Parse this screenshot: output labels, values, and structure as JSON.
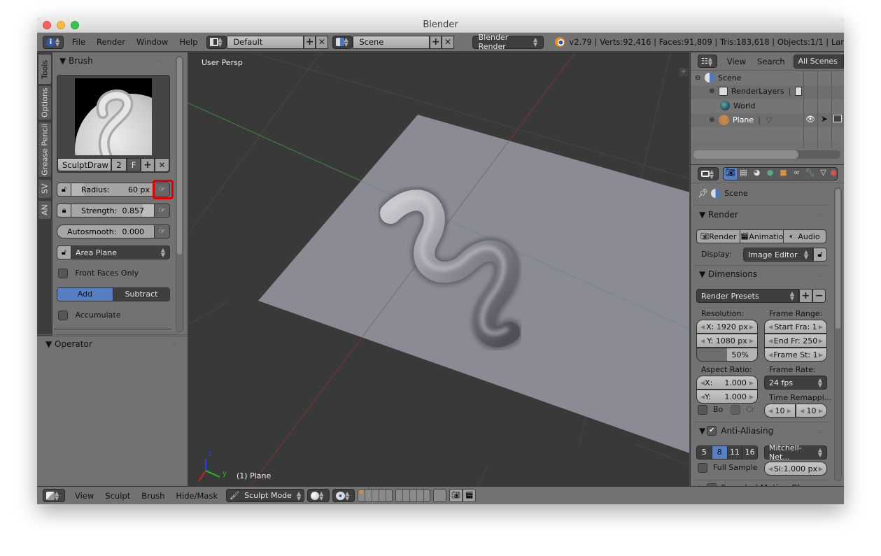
{
  "window": {
    "title": "Blender"
  },
  "topbar": {
    "menus": [
      "File",
      "Render",
      "Window",
      "Help"
    ],
    "layout": "Default",
    "scene": "Scene",
    "engine": "Blender Render",
    "stats": "v2.79 | Verts:92,416 | Faces:91,809 | Tris:183,618 | Objects:1/1 | Lar"
  },
  "toolshelf": {
    "tabs": [
      "Tools",
      "Options",
      "Grease Pencil",
      "SV",
      "AN"
    ],
    "brush_panel": "Brush",
    "brush_name": "SculptDraw",
    "brush_users": "2",
    "fake_user": "F",
    "radius_label": "Radius:",
    "radius_value": "60 px",
    "strength_label": "Strength:",
    "strength_value": "0.857",
    "strength_fraction": 0.857,
    "autosmooth_label": "Autosmooth:",
    "autosmooth_value": "0.000",
    "sculpt_plane": "Area Plane",
    "front_faces_only": "Front Faces Only",
    "add_label": "Add",
    "subtract_label": "Subtract",
    "accumulate": "Accumulate",
    "operator_panel": "Operator"
  },
  "viewport": {
    "view_name": "User Persp",
    "object_label": "(1) Plane",
    "axis_labels": {
      "z": "z",
      "y": "y",
      "x": "x"
    }
  },
  "outliner": {
    "menus": [
      "View",
      "Search"
    ],
    "filter": "All Scenes",
    "items": [
      {
        "label": "Scene",
        "depth": 0
      },
      {
        "label": "RenderLayers",
        "depth": 1
      },
      {
        "label": "World",
        "depth": 1
      },
      {
        "label": "Plane",
        "depth": 1
      }
    ]
  },
  "properties": {
    "context": "Scene",
    "render_panel": "Render",
    "render_btn": "Render",
    "animation_btn": "Animatio",
    "audio_btn": "Audio",
    "display_label": "Display:",
    "display_value": "Image Editor",
    "dimensions_panel": "Dimensions",
    "render_presets": "Render Presets",
    "resolution_label": "Resolution:",
    "res_x": "X: 1920 px",
    "res_y": "Y: 1080 px",
    "res_percent": "50%",
    "frame_range_label": "Frame Range:",
    "start_frame": "Start Fra:  1",
    "end_frame": "End Fr: 250",
    "frame_step": "Frame St: 1",
    "aspect_label": "Aspect Ratio:",
    "aspect_x_label": "X:",
    "aspect_x": "1.000",
    "aspect_y_label": "Y:",
    "aspect_y": "1.000",
    "frame_rate_label": "Frame Rate:",
    "frame_rate": "24 fps",
    "time_remap_label": "Time Remappi...",
    "remap_old": "10",
    "remap_new": "10",
    "border_label": "Bo",
    "crop_label": "Cr",
    "aa_panel": "Anti-Aliasing",
    "aa_samples": [
      "5",
      "8",
      "11",
      "16"
    ],
    "aa_selected": "8",
    "aa_filter": "Mitchell-Net...",
    "full_sample": "Full Sample",
    "filter_size": "Si:1.000 px",
    "motion_blur_panel": "Sampled Motion Blur"
  },
  "bottombar": {
    "menus": [
      "View",
      "Sculpt",
      "Brush",
      "Hide/Mask"
    ],
    "mode": "Sculpt Mode"
  },
  "colors": {
    "accent": "#5680c2",
    "highlight": "#e00000"
  }
}
